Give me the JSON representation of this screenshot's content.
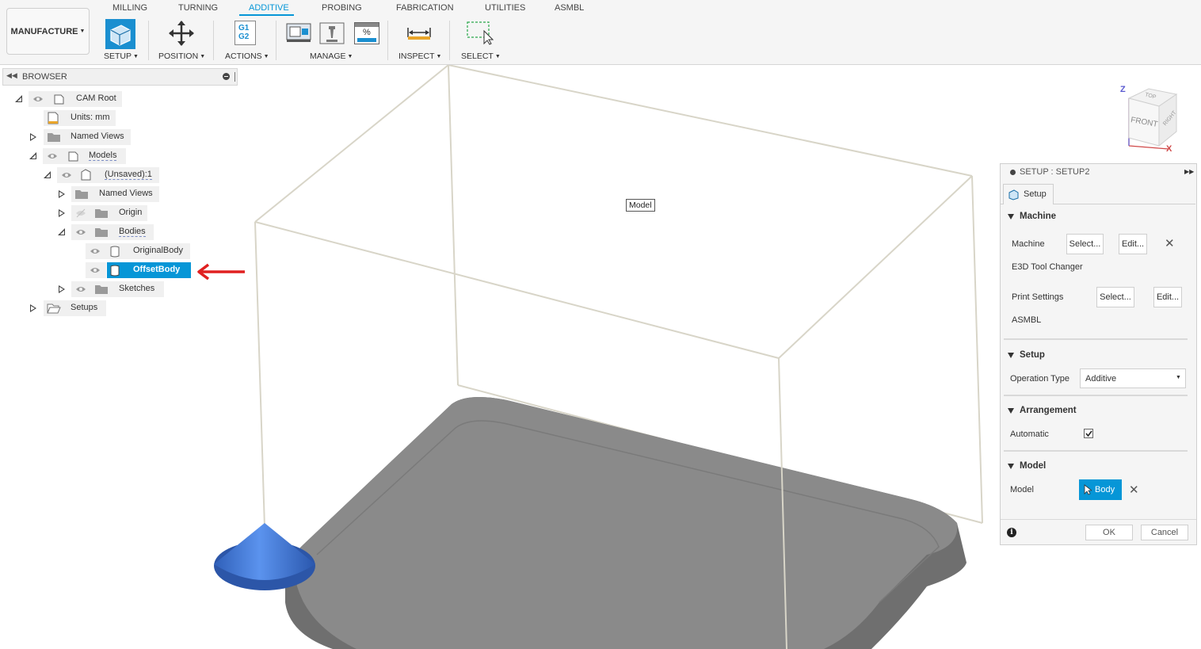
{
  "toolbar": {
    "workspace": "MANUFACTURE",
    "tabs": [
      "MILLING",
      "TURNING",
      "ADDITIVE",
      "PROBING",
      "FABRICATION",
      "UTILITIES",
      "ASMBL"
    ],
    "active_tab": "ADDITIVE",
    "groups": {
      "setup": "SETUP",
      "position": "POSITION",
      "actions": "ACTIONS",
      "manage": "MANAGE",
      "inspect": "INSPECT",
      "select": "SELECT"
    },
    "actions_icon_text": [
      "G1",
      "G2"
    ],
    "percent_icon_text": "%"
  },
  "browser": {
    "title": "BROWSER",
    "nodes": {
      "cam_root": "CAM Root",
      "units": "Units: mm",
      "named_views_root": "Named Views",
      "models": "Models",
      "unsaved": "(Unsaved):1",
      "named_views": "Named Views",
      "origin": "Origin",
      "bodies": "Bodies",
      "original_body": "OriginalBody",
      "offset_body": "OffsetBody",
      "sketches": "Sketches",
      "setups": "Setups"
    }
  },
  "viewport": {
    "model_label": "Model",
    "viewcube": {
      "top": "TOP",
      "front": "FRONT",
      "right": "RIGHT",
      "axis_z": "Z",
      "axis_x": "X"
    }
  },
  "setup_panel": {
    "title": "SETUP : SETUP2",
    "tab": "Setup",
    "machine_section": "Machine",
    "machine_label": "Machine",
    "machine_select": "Select...",
    "machine_edit": "Edit...",
    "machine_name": "E3D Tool Changer",
    "print_settings_label": "Print Settings",
    "print_select": "Select...",
    "print_edit": "Edit...",
    "print_name": "ASMBL",
    "setup_section": "Setup",
    "operation_type_label": "Operation Type",
    "operation_type_value": "Additive",
    "arrangement_section": "Arrangement",
    "automatic_label": "Automatic",
    "automatic_checked": true,
    "model_section": "Model",
    "model_label": "Model",
    "model_button": "Body",
    "ok": "OK",
    "cancel": "Cancel"
  },
  "colors": {
    "accent": "#0696d7",
    "arrow": "#e02020",
    "body_gray": "#7d7d7d",
    "cone_blue": "#3a72d8"
  }
}
